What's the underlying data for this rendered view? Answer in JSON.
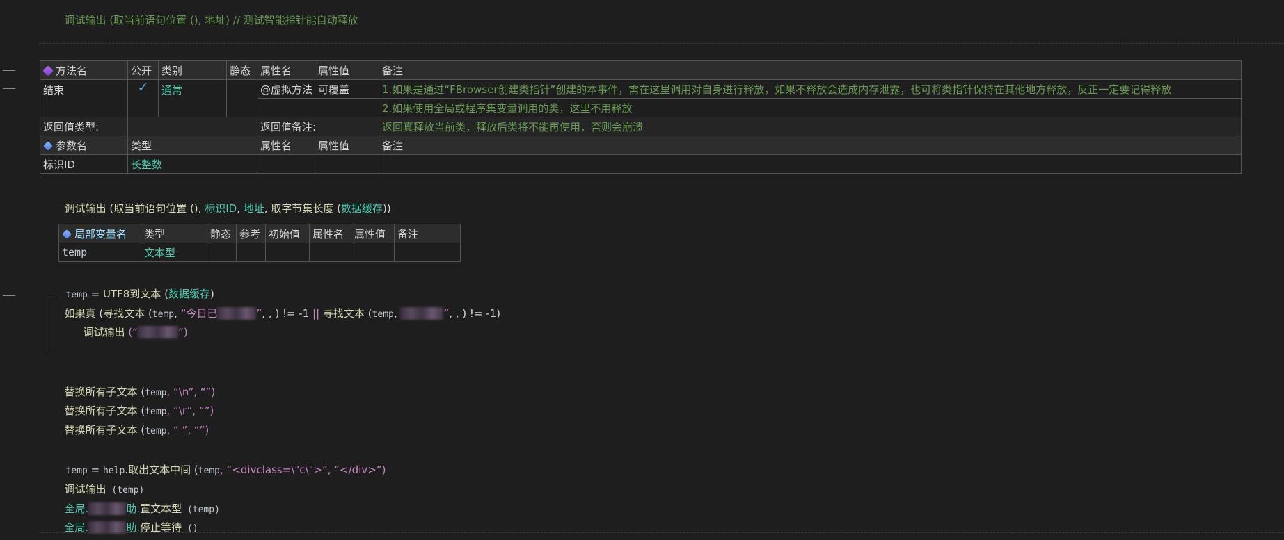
{
  "top_line": {
    "text": "调试输出 (取当前语句位置 (), 地址) // 测试智能指针能自动释放"
  },
  "method_table": {
    "headers": [
      "方法名",
      "公开",
      "类别",
      "静态",
      "属性名",
      "属性值",
      "备注"
    ],
    "name": "结束",
    "public_check": "✓",
    "category": "通常",
    "attr_name": "@虚拟方法",
    "attr_value": "可覆盖",
    "remark1": "1.如果是通过“FBrowser创建类指针”创建的本事件，需在这里调用对自身进行释放，如果不释放会造成内存泄露，也可将类指针保持在其他地方释放，反正一定要记得释放",
    "remark2": "2.如果使用全局或程序集变量调用的类，这里不用释放",
    "return_type_label": "返回值类型:",
    "return_remark_label": "返回值备注:",
    "return_remark": "返回真释放当前类，释放后类将不能再使用，否则会崩溃",
    "param_headers": [
      "参数名",
      "类型",
      "属性名",
      "属性值",
      "备注"
    ],
    "param_name": "标识ID",
    "param_type": "长整数"
  },
  "debug_line2": {
    "fn": "调试输出",
    "open": " (",
    "a1": "取当前语句位置 ()",
    "s1": ", ",
    "a2": "标识ID",
    "s2": ", ",
    "a3": "地址",
    "s3": ", ",
    "a4": "取字节集长度",
    "a5": " (",
    "a6": "数据缓存",
    "close": "))"
  },
  "local_table": {
    "headers": [
      "局部变量名",
      "类型",
      "静态",
      "参考",
      "初始值",
      "属性名",
      "属性值",
      "备注"
    ],
    "var_name": "temp",
    "var_type": "文本型"
  },
  "code": {
    "l1_var": "temp",
    "l1_op": " = ",
    "l1_fn": "UTF8到文本",
    "l1_open": " (",
    "l1_arg": "数据缓存",
    "l1_close": ")",
    "if_fn": "如果真",
    "if_open": " (",
    "if_find1": "寻找文本",
    "if_p1": " (",
    "if_var1": "temp",
    "if_c1": ", ",
    "if_str1": "“今日已",
    "if_str1_end": "”",
    "if_tail1": ", , ) != -1 ",
    "if_or": "||",
    "if_find2": " 寻找文本",
    "if_p2": " (",
    "if_var2": "temp",
    "if_c2": ", ",
    "if_str2_end": "”",
    "if_tail2": ", , ) != -1)",
    "dbg_fn": "调试输出",
    "dbg_open": " (“",
    "dbg_close": "”)",
    "rep_fn": "替换所有子文本",
    "rep_open": " (",
    "rep_var": "temp",
    "rep1_arg": ", “\\n”, “”)",
    "rep2_arg": ", “\\r”, “”)",
    "rep3_arg": ", “ ”, “”)",
    "mid_var": "temp",
    "mid_op": " = ",
    "mid_obj": "help",
    "mid_dot": ".",
    "mid_fn": "取出文本中间",
    "mid_open": " (",
    "mid_arg_var": "temp",
    "mid_args": ", “<divclass=\\\"c\\\">”, “</div>”)",
    "out_fn": "调试输出",
    "out_arg": " (temp)",
    "g1_prefix": "全局.",
    "g1_suffix": "助.",
    "g1_fn": "置文本型",
    "g1_arg": " (temp)",
    "g2_prefix": "全局.",
    "g2_suffix": "助.",
    "g2_fn": "停止等待",
    "g2_arg": " ()"
  }
}
